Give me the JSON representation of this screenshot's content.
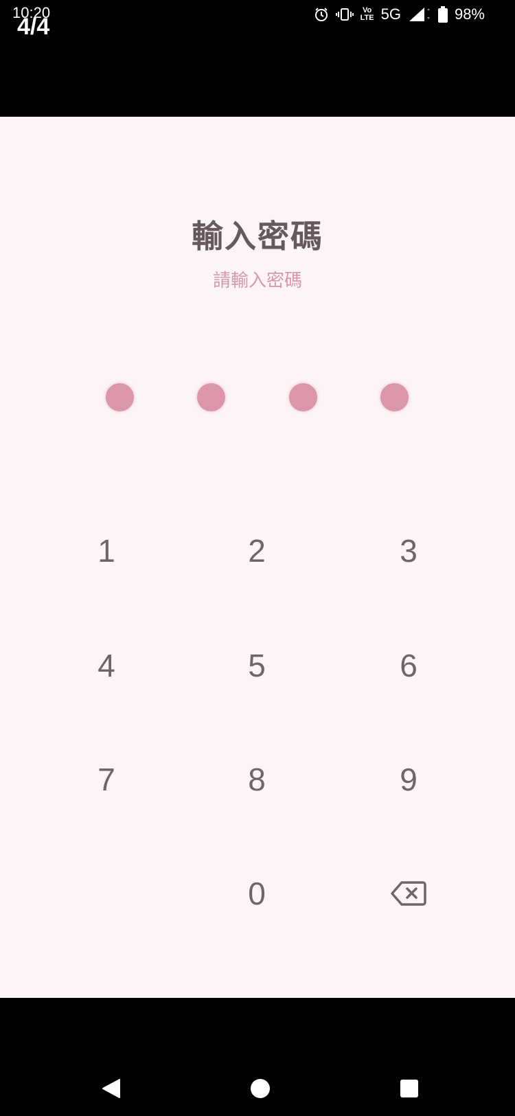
{
  "status_bar": {
    "time": "10:20",
    "counter": "4/4",
    "network_top": "Vo",
    "network_bottom": "LTE",
    "network_type": "5G",
    "battery": "98%",
    "icons": [
      "alarm-icon",
      "vibrate-icon",
      "volte-icon",
      "signal-icon",
      "battery-icon"
    ]
  },
  "screen": {
    "title": "輸入密碼",
    "subtitle": "請輸入密碼"
  },
  "pin": {
    "length": 4,
    "filled": 4,
    "dot_color": "#dc96aa"
  },
  "keypad": {
    "keys": [
      "1",
      "2",
      "3",
      "4",
      "5",
      "6",
      "7",
      "8",
      "9",
      "0"
    ],
    "backspace_icon": "backspace-icon"
  },
  "nav_bar": {
    "icons": [
      "back-icon",
      "home-icon",
      "recents-icon"
    ]
  },
  "colors": {
    "background": "#fcf4f6",
    "title": "#66595d",
    "subtitle": "#d898ab",
    "key_text": "#6f6468"
  }
}
